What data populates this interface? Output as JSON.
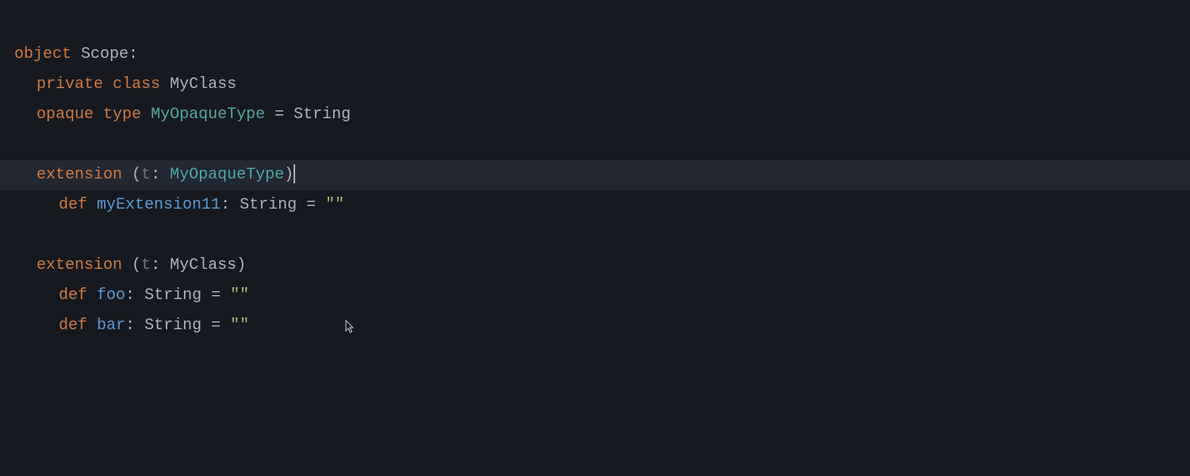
{
  "code": {
    "line1": {
      "kw_object": "object",
      "name": "Scope",
      "colon": ":"
    },
    "line2": {
      "kw_private": "private",
      "kw_class": "class",
      "name": "MyClass"
    },
    "line3": {
      "kw_opaque": "opaque",
      "kw_type": "type",
      "name": "MyOpaqueType",
      "eq": " = ",
      "rhs": "String"
    },
    "line5": {
      "kw_extension": "extension",
      "lparen": " (",
      "param": "t",
      "colon": ": ",
      "ptype": "MyOpaqueType",
      "rparen": ")"
    },
    "line6": {
      "kw_def": "def",
      "name": "myExtension11",
      "colon": ": ",
      "rtype": "String",
      "eq": " = ",
      "str": "\"\""
    },
    "line8": {
      "kw_extension": "extension",
      "lparen": " (",
      "param": "t",
      "colon": ": ",
      "ptype": "MyClass",
      "rparen": ")"
    },
    "line9": {
      "kw_def": "def",
      "name": "foo",
      "colon": ": ",
      "rtype": "String",
      "eq": " = ",
      "str": "\"\""
    },
    "line10": {
      "kw_def": "def",
      "name": "bar",
      "colon": ": ",
      "rtype": "String",
      "eq": " = ",
      "str": "\"\""
    }
  }
}
